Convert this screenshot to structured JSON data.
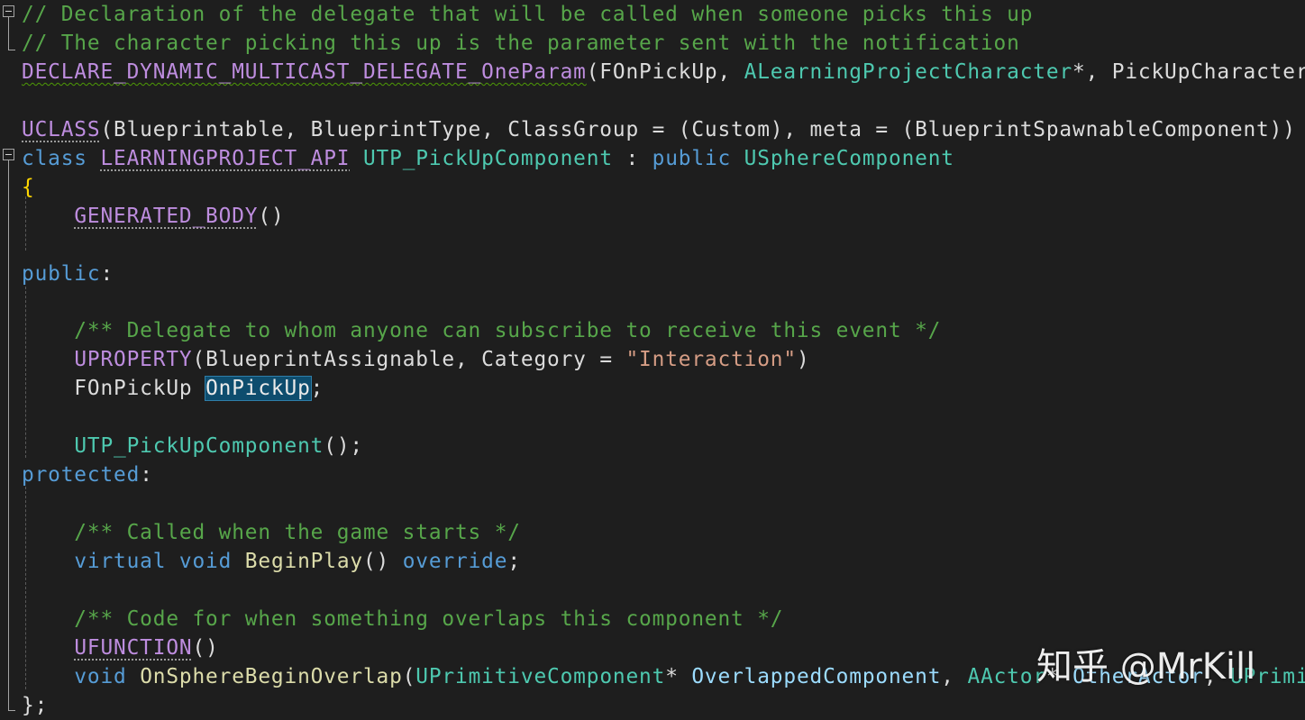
{
  "colors": {
    "background": "#1e1e1e",
    "comment": "#57a64a",
    "keyword": "#569cd6",
    "macro": "#be8ddf",
    "type": "#4ec9b0",
    "string": "#d69d85",
    "function": "#dcdcaa",
    "parameter": "#9cdcfe",
    "plain": "#dcdcdc",
    "brace": "#ffd700"
  },
  "icons": {
    "fold_toggle": "collapse-box-icon"
  },
  "editor": {
    "lines": [
      {
        "tokens": [
          {
            "t": "// Declaration of the delegate that will be called when someone picks this up",
            "c": "comment"
          }
        ]
      },
      {
        "tokens": [
          {
            "t": "// The character picking this up is the parameter sent with the notification",
            "c": "comment"
          }
        ]
      },
      {
        "tokens": [
          {
            "t": "DECLARE_DYNAMIC_MULTICAST_DELEGATE_OneParam",
            "c": "macro",
            "d": "squiggle"
          },
          {
            "t": "(FOnPickUp, ",
            "c": "plain"
          },
          {
            "t": "ALearningProjectCharacter",
            "c": "type"
          },
          {
            "t": "*, PickUpCharacter);",
            "c": "plain"
          }
        ]
      },
      {
        "tokens": []
      },
      {
        "tokens": [
          {
            "t": "UCLASS",
            "c": "macro",
            "d": "dots"
          },
          {
            "t": "(Blueprintable, BlueprintType, ClassGroup = (Custom), meta = (BlueprintSpawnableComponent))",
            "c": "plain"
          }
        ]
      },
      {
        "tokens": [
          {
            "t": "class ",
            "c": "keyword"
          },
          {
            "t": "LEARNINGPROJECT_API",
            "c": "macro",
            "d": "dots"
          },
          {
            "t": " ",
            "c": "plain"
          },
          {
            "t": "UTP_PickUpComponent",
            "c": "type"
          },
          {
            "t": " : ",
            "c": "plain"
          },
          {
            "t": "public ",
            "c": "keyword"
          },
          {
            "t": "USphereComponent",
            "c": "type"
          }
        ]
      },
      {
        "tokens": [
          {
            "t": "{",
            "c": "brace"
          }
        ]
      },
      {
        "tokens": [
          {
            "t": "    ",
            "c": "plain"
          },
          {
            "t": "GENERATED_BODY",
            "c": "macro",
            "d": "dots"
          },
          {
            "t": "()",
            "c": "plain"
          }
        ]
      },
      {
        "tokens": []
      },
      {
        "tokens": [
          {
            "t": "public",
            "c": "keyword"
          },
          {
            "t": ":",
            "c": "plain"
          }
        ]
      },
      {
        "tokens": []
      },
      {
        "tokens": [
          {
            "t": "    /** Delegate to whom anyone can subscribe to receive this event */",
            "c": "comment"
          }
        ]
      },
      {
        "tokens": [
          {
            "t": "    ",
            "c": "plain"
          },
          {
            "t": "UPROPERTY",
            "c": "macro"
          },
          {
            "t": "(BlueprintAssignable, Category = ",
            "c": "plain"
          },
          {
            "t": "\"Interaction\"",
            "c": "string"
          },
          {
            "t": ")",
            "c": "plain"
          }
        ]
      },
      {
        "tokens": [
          {
            "t": "    FOnPickUp ",
            "c": "plain"
          },
          {
            "t": "OnPickUp",
            "c": "param",
            "d": "highlight"
          },
          {
            "t": ";",
            "c": "plain"
          }
        ]
      },
      {
        "tokens": []
      },
      {
        "tokens": [
          {
            "t": "    ",
            "c": "plain"
          },
          {
            "t": "UTP_PickUpComponent",
            "c": "type"
          },
          {
            "t": "();",
            "c": "plain"
          }
        ]
      },
      {
        "tokens": [
          {
            "t": "protected",
            "c": "keyword"
          },
          {
            "t": ":",
            "c": "plain"
          }
        ]
      },
      {
        "tokens": []
      },
      {
        "tokens": [
          {
            "t": "    /** Called when the game starts */",
            "c": "comment"
          }
        ]
      },
      {
        "tokens": [
          {
            "t": "    ",
            "c": "plain"
          },
          {
            "t": "virtual void ",
            "c": "keyword"
          },
          {
            "t": "BeginPlay",
            "c": "func"
          },
          {
            "t": "() ",
            "c": "plain"
          },
          {
            "t": "override",
            "c": "keyword"
          },
          {
            "t": ";",
            "c": "plain"
          }
        ]
      },
      {
        "tokens": []
      },
      {
        "tokens": [
          {
            "t": "    /** Code for when something overlaps this component */",
            "c": "comment"
          }
        ]
      },
      {
        "tokens": [
          {
            "t": "    ",
            "c": "plain"
          },
          {
            "t": "UFUNCTION",
            "c": "macro",
            "d": "dots"
          },
          {
            "t": "()",
            "c": "plain"
          }
        ]
      },
      {
        "tokens": [
          {
            "t": "    ",
            "c": "plain"
          },
          {
            "t": "void ",
            "c": "keyword"
          },
          {
            "t": "OnSphereBeginOverlap",
            "c": "func"
          },
          {
            "t": "(",
            "c": "plain"
          },
          {
            "t": "UPrimitiveComponent",
            "c": "type"
          },
          {
            "t": "* ",
            "c": "plain"
          },
          {
            "t": "OverlappedComponent",
            "c": "param"
          },
          {
            "t": ", ",
            "c": "plain"
          },
          {
            "t": "AActor",
            "c": "type"
          },
          {
            "t": "* ",
            "c": "plain"
          },
          {
            "t": "OtherActor",
            "c": "param"
          },
          {
            "t": ", ",
            "c": "plain"
          },
          {
            "t": "UPrimitiveComponent",
            "c": "type"
          }
        ]
      },
      {
        "tokens": [
          {
            "t": "};",
            "c": "plain"
          }
        ]
      }
    ]
  },
  "watermark": {
    "text": "知乎 @MrKill"
  }
}
